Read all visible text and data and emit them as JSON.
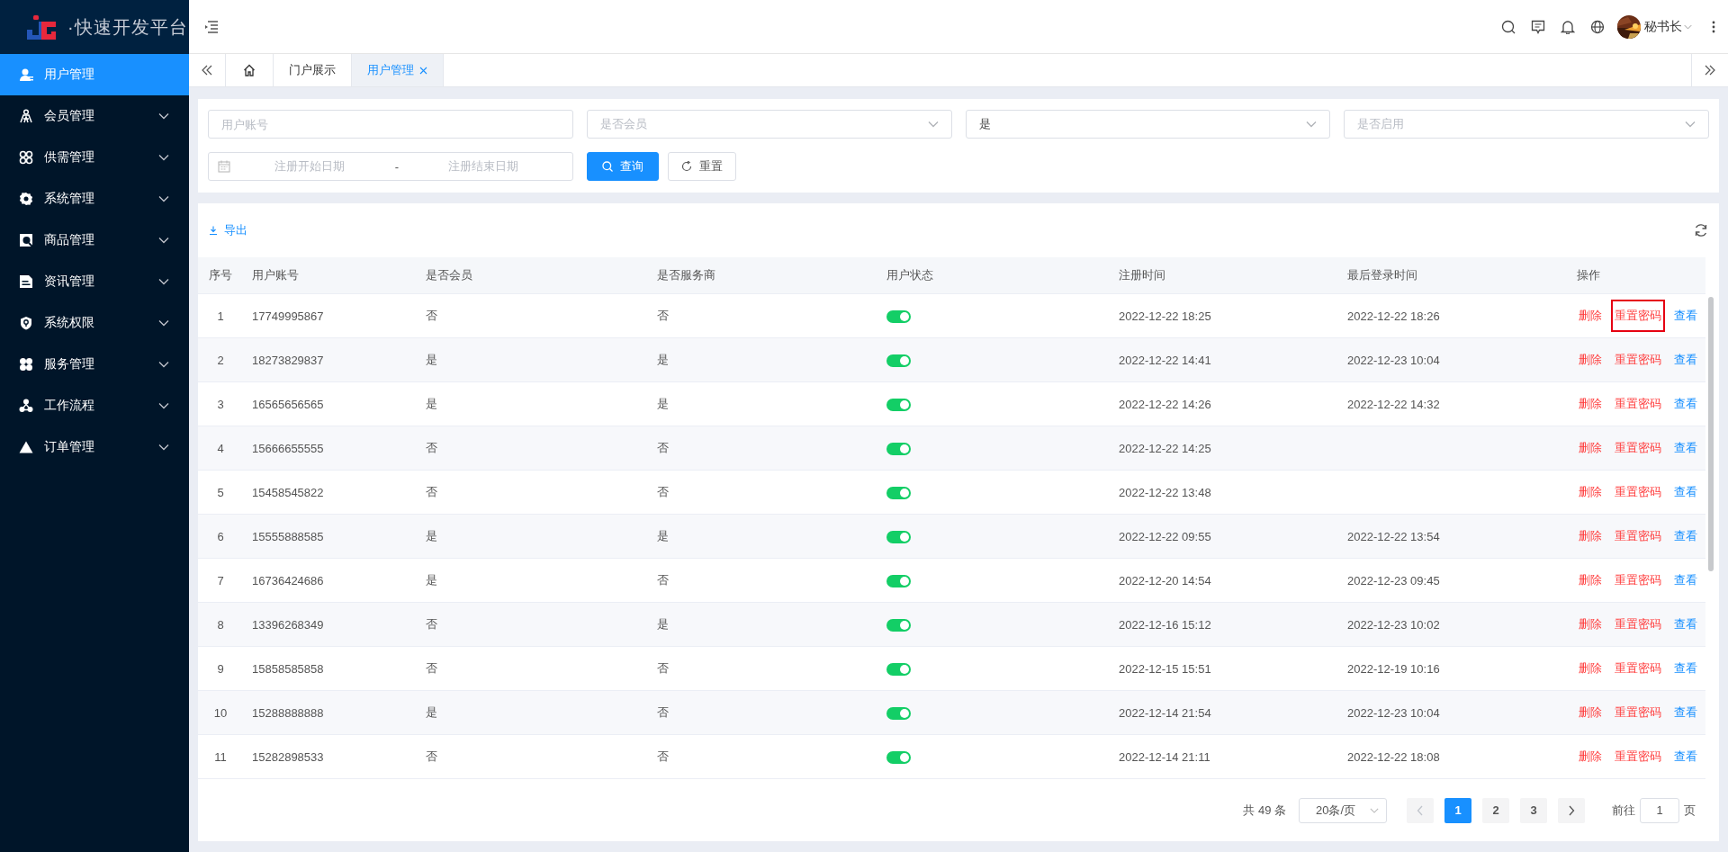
{
  "logo": {
    "text": "·快速开发平台"
  },
  "sidebar": {
    "items": [
      {
        "label": "用户管理",
        "selected": true,
        "expandable": false
      },
      {
        "label": "会员管理",
        "selected": false,
        "expandable": true
      },
      {
        "label": "供需管理",
        "selected": false,
        "expandable": true
      },
      {
        "label": "系统管理",
        "selected": false,
        "expandable": true
      },
      {
        "label": "商品管理",
        "selected": false,
        "expandable": true
      },
      {
        "label": "资讯管理",
        "selected": false,
        "expandable": true
      },
      {
        "label": "系统权限",
        "selected": false,
        "expandable": true
      },
      {
        "label": "服务管理",
        "selected": false,
        "expandable": true
      },
      {
        "label": "工作流程",
        "selected": false,
        "expandable": true
      },
      {
        "label": "订单管理",
        "selected": false,
        "expandable": true
      }
    ]
  },
  "header": {
    "user_name": "秘书长"
  },
  "tabs": [
    {
      "kind": "home",
      "selected": false,
      "closable": false
    },
    {
      "kind": "page",
      "label": "门户展示",
      "selected": false,
      "closable": false
    },
    {
      "kind": "page",
      "label": "用户管理",
      "selected": true,
      "closable": true
    }
  ],
  "filters": [
    {
      "kind": "input",
      "placeholder": "用户账号"
    },
    {
      "kind": "select",
      "placeholder": "是否会员"
    },
    {
      "kind": "select",
      "value": "是"
    },
    {
      "kind": "select",
      "placeholder": "是否启用"
    },
    {
      "kind": "daterange",
      "start_placeholder": "注册开始日期",
      "separator": "-",
      "end_placeholder": "注册结束日期"
    }
  ],
  "buttons": [
    {
      "kind": "primary",
      "label": "查询"
    },
    {
      "kind": "default",
      "label": "重置"
    }
  ],
  "toolbar": {
    "export": "导出"
  },
  "table": {
    "columns": [
      "序号",
      "用户账号",
      "是否会员",
      "是否服务商",
      "用户状态",
      "注册时间",
      "最后登录时间",
      "操作"
    ],
    "rows": [
      {
        "index": "1",
        "account": "17749995867",
        "member": "否",
        "provider": "否",
        "enabled": true,
        "registered": "2022-12-22 18:25",
        "last_login": "2022-12-22 18:26",
        "actions": [
          {
            "kind": "danger",
            "label": "删除"
          },
          {
            "kind": "danger",
            "label": "重置密码",
            "highlighted": true
          },
          {
            "kind": "info",
            "label": "查看"
          }
        ]
      },
      {
        "index": "2",
        "account": "18273829837",
        "member": "是",
        "provider": "是",
        "enabled": true,
        "registered": "2022-12-22 14:41",
        "last_login": "2022-12-23 10:04",
        "actions": [
          {
            "kind": "danger",
            "label": "删除"
          },
          {
            "kind": "danger",
            "label": "重置密码",
            "highlighted": false
          },
          {
            "kind": "info",
            "label": "查看"
          }
        ]
      },
      {
        "index": "3",
        "account": "16565656565",
        "member": "是",
        "provider": "是",
        "enabled": true,
        "registered": "2022-12-22 14:26",
        "last_login": "2022-12-22 14:32",
        "actions": [
          {
            "kind": "danger",
            "label": "删除"
          },
          {
            "kind": "danger",
            "label": "重置密码",
            "highlighted": false
          },
          {
            "kind": "info",
            "label": "查看"
          }
        ]
      },
      {
        "index": "4",
        "account": "15666655555",
        "member": "否",
        "provider": "否",
        "enabled": true,
        "registered": "2022-12-22 14:25",
        "actions": [
          {
            "kind": "danger",
            "label": "删除"
          },
          {
            "kind": "danger",
            "label": "重置密码",
            "highlighted": false
          },
          {
            "kind": "info",
            "label": "查看"
          }
        ]
      },
      {
        "index": "5",
        "account": "15458545822",
        "member": "否",
        "provider": "否",
        "enabled": true,
        "registered": "2022-12-22 13:48",
        "actions": [
          {
            "kind": "danger",
            "label": "删除"
          },
          {
            "kind": "danger",
            "label": "重置密码",
            "highlighted": false
          },
          {
            "kind": "info",
            "label": "查看"
          }
        ]
      },
      {
        "index": "6",
        "account": "15555888585",
        "member": "是",
        "provider": "是",
        "enabled": true,
        "registered": "2022-12-22 09:55",
        "last_login": "2022-12-22 13:54",
        "actions": [
          {
            "kind": "danger",
            "label": "删除"
          },
          {
            "kind": "danger",
            "label": "重置密码",
            "highlighted": false
          },
          {
            "kind": "info",
            "label": "查看"
          }
        ]
      },
      {
        "index": "7",
        "account": "16736424686",
        "member": "是",
        "provider": "否",
        "enabled": true,
        "registered": "2022-12-20 14:54",
        "last_login": "2022-12-23 09:45",
        "actions": [
          {
            "kind": "danger",
            "label": "删除"
          },
          {
            "kind": "danger",
            "label": "重置密码",
            "highlighted": false
          },
          {
            "kind": "info",
            "label": "查看"
          }
        ]
      },
      {
        "index": "8",
        "account": "13396268349",
        "member": "否",
        "provider": "是",
        "enabled": true,
        "registered": "2022-12-16 15:12",
        "last_login": "2022-12-23 10:02",
        "actions": [
          {
            "kind": "danger",
            "label": "删除"
          },
          {
            "kind": "danger",
            "label": "重置密码",
            "highlighted": false
          },
          {
            "kind": "info",
            "label": "查看"
          }
        ]
      },
      {
        "index": "9",
        "account": "15858585858",
        "member": "否",
        "provider": "否",
        "enabled": true,
        "registered": "2022-12-15 15:51",
        "last_login": "2022-12-19 10:16",
        "actions": [
          {
            "kind": "danger",
            "label": "删除"
          },
          {
            "kind": "danger",
            "label": "重置密码",
            "highlighted": false
          },
          {
            "kind": "info",
            "label": "查看"
          }
        ]
      },
      {
        "index": "10",
        "account": "15288888888",
        "member": "是",
        "provider": "否",
        "enabled": true,
        "registered": "2022-12-14 21:54",
        "last_login": "2022-12-23 10:04",
        "actions": [
          {
            "kind": "danger",
            "label": "删除"
          },
          {
            "kind": "danger",
            "label": "重置密码",
            "highlighted": false
          },
          {
            "kind": "info",
            "label": "查看"
          }
        ]
      },
      {
        "index": "11",
        "account": "15282898533",
        "member": "否",
        "provider": "否",
        "enabled": true,
        "registered": "2022-12-14 21:11",
        "last_login": "2022-12-22 18:08",
        "actions": [
          {
            "kind": "danger",
            "label": "删除"
          },
          {
            "kind": "danger",
            "label": "重置密码",
            "highlighted": false
          },
          {
            "kind": "info",
            "label": "查看"
          }
        ]
      }
    ]
  },
  "pagination": {
    "total": "共 49 条",
    "page_size": "20条/页",
    "pages": [
      {
        "label": "1",
        "selected": true
      },
      {
        "label": "2",
        "selected": false
      },
      {
        "label": "3",
        "selected": false
      }
    ],
    "goto_label": "前往",
    "goto_value": "1",
    "goto_suffix": "页"
  }
}
